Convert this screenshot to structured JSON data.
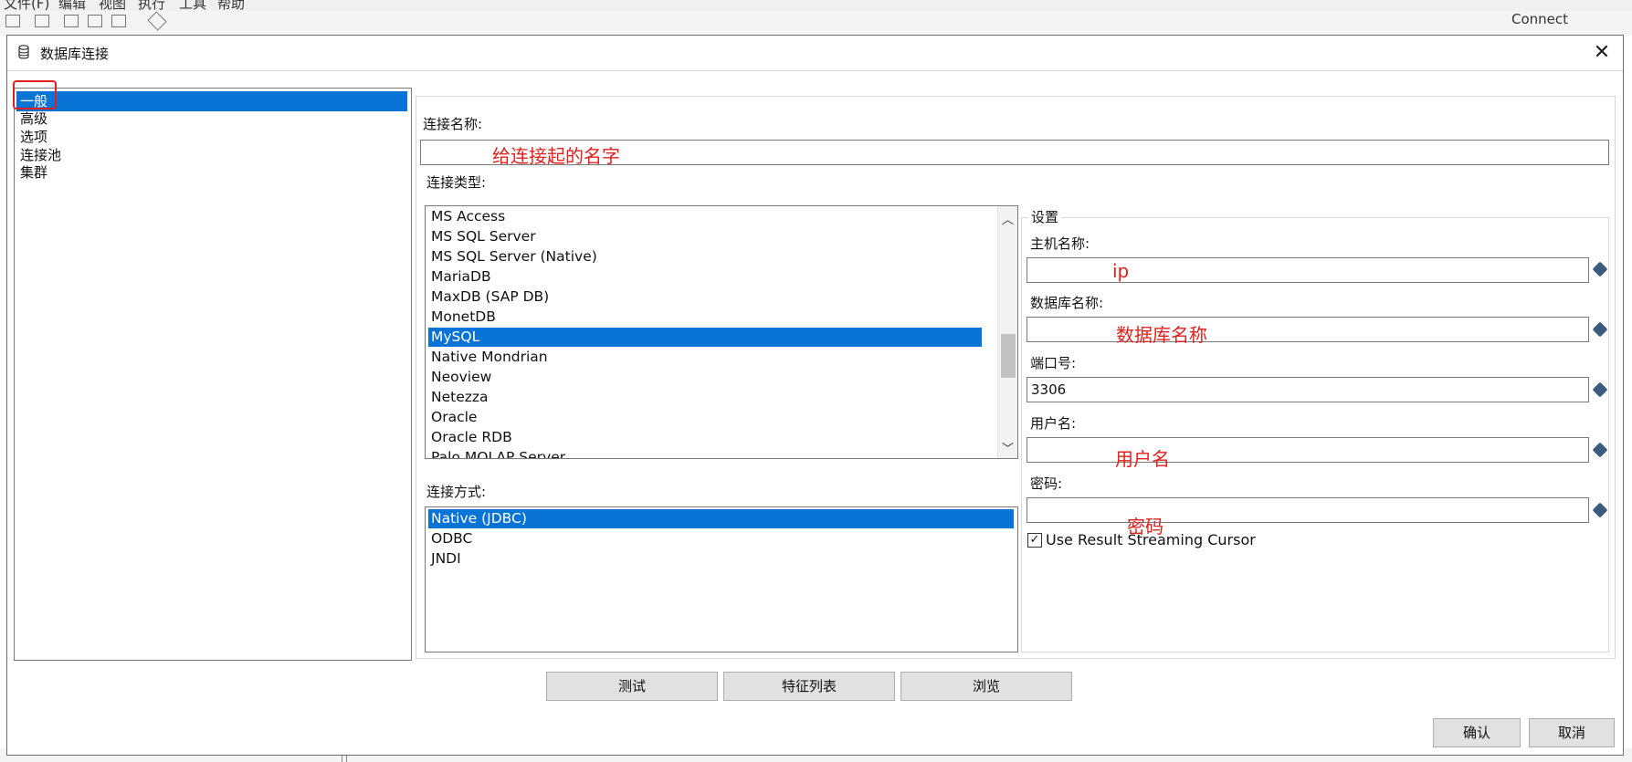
{
  "background_app": {
    "menu": [
      "文件(F)",
      "编辑",
      "视图",
      "执行",
      "工具",
      "帮助"
    ],
    "right_text": "Connect"
  },
  "dialog": {
    "title": "数据库连接",
    "close_glyph": "✕",
    "nav_items": [
      "一般",
      "高级",
      "选项",
      "连接池",
      "集群"
    ],
    "connection_name": {
      "label": "连接名称:",
      "value": "",
      "annotation": "给连接起的名字"
    },
    "connection_type": {
      "label": "连接类型:",
      "items": [
        "MS Access",
        "MS SQL Server",
        "MS SQL Server (Native)",
        "MariaDB",
        "MaxDB (SAP DB)",
        "MonetDB",
        "MySQL",
        "Native Mondrian",
        "Neoview",
        "Netezza",
        "Oracle",
        "Oracle RDB",
        "Palo MOLAP Server"
      ],
      "selected": "MySQL"
    },
    "access": {
      "label": "连接方式:",
      "items": [
        "Native (JDBC)",
        "ODBC",
        "JNDI"
      ],
      "selected": "Native (JDBC)"
    },
    "settings": {
      "title": "设置",
      "host": {
        "label": "主机名称:",
        "value": "",
        "annotation": "ip"
      },
      "dbname": {
        "label": "数据库名称:",
        "value": "",
        "annotation": "数据库名称"
      },
      "port": {
        "label": "端口号:",
        "value": "3306"
      },
      "user": {
        "label": "用户名:",
        "value": "",
        "annotation": "用户名"
      },
      "password": {
        "label": "密码:",
        "value": "",
        "annotation": "密码"
      },
      "streaming_cursor": {
        "label": "Use Result Streaming Cursor",
        "checked": true,
        "mark": "✓"
      }
    },
    "buttons": {
      "test": "测试",
      "features": "特征列表",
      "browse": "浏览",
      "ok": "确认",
      "cancel": "取消"
    }
  },
  "colors": {
    "selection": "#0a73d6",
    "annotation": "#e0201c",
    "highlight_box": "#e02020"
  }
}
